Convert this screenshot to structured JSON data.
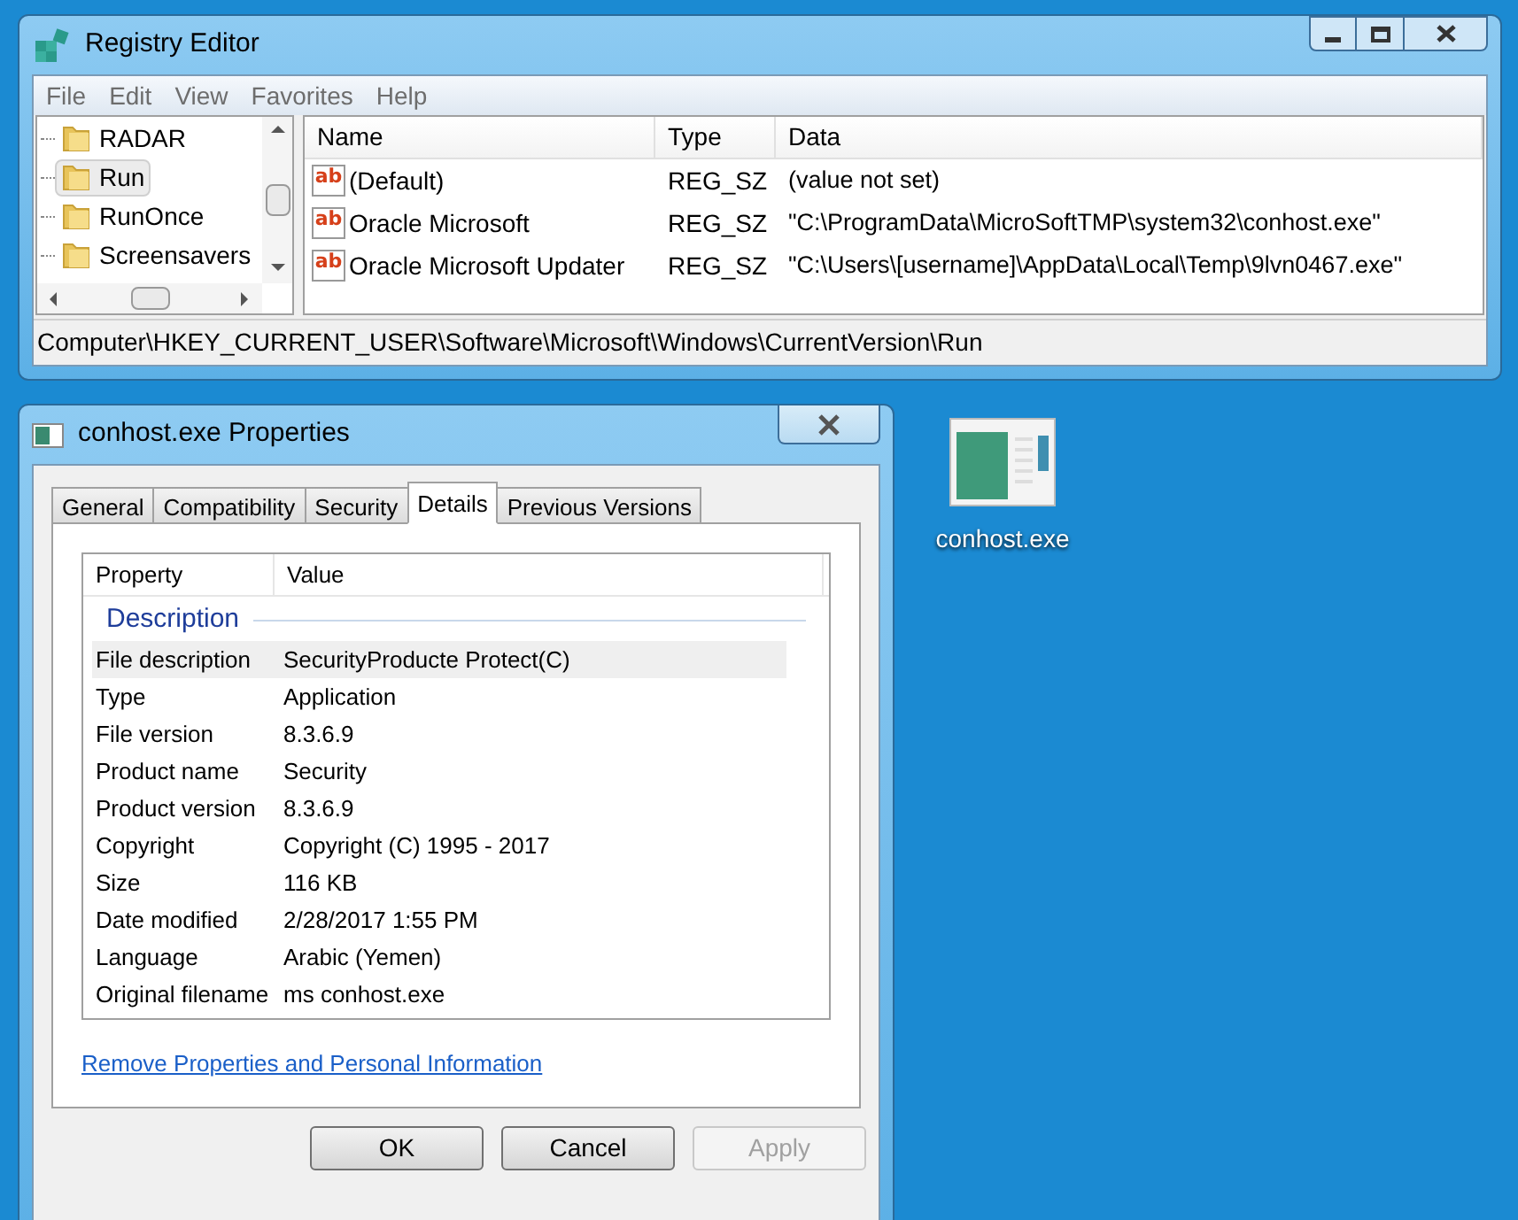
{
  "registry_editor": {
    "title": "Registry Editor",
    "menu": [
      "File",
      "Edit",
      "View",
      "Favorites",
      "Help"
    ],
    "tree": [
      {
        "label": "RADAR",
        "selected": false
      },
      {
        "label": "Run",
        "selected": true
      },
      {
        "label": "RunOnce",
        "selected": false
      },
      {
        "label": "Screensavers",
        "selected": false
      }
    ],
    "columns": [
      "Name",
      "Type",
      "Data"
    ],
    "rows": [
      {
        "icon": "ab",
        "name": "(Default)",
        "type": "REG_SZ",
        "data": "(value not set)"
      },
      {
        "icon": "ab",
        "name": "Oracle Microsoft",
        "type": "REG_SZ",
        "data": "\"C:\\ProgramData\\MicroSoftTMP\\system32\\conhost.exe\""
      },
      {
        "icon": "ab",
        "name": "Oracle Microsoft Updater",
        "type": "REG_SZ",
        "data": "\"C:\\Users\\[username]\\AppData\\Local\\Temp\\9lvn0467.exe\""
      }
    ],
    "status_bar": "Computer\\HKEY_CURRENT_USER\\Software\\Microsoft\\Windows\\CurrentVersion\\Run"
  },
  "properties_dialog": {
    "title": "conhost.exe Properties",
    "tabs": [
      {
        "label": "General",
        "selected": false
      },
      {
        "label": "Compatibility",
        "selected": false
      },
      {
        "label": "Security",
        "selected": false
      },
      {
        "label": "Details",
        "selected": true
      },
      {
        "label": "Previous Versions",
        "selected": false
      }
    ],
    "columns": [
      "Property",
      "Value"
    ],
    "section": "Description",
    "rows": [
      {
        "property": "File description",
        "value": "SecurityProducte Protect(C)",
        "selected": true
      },
      {
        "property": "Type",
        "value": "Application",
        "selected": false
      },
      {
        "property": "File version",
        "value": "8.3.6.9",
        "selected": false
      },
      {
        "property": "Product name",
        "value": "Security",
        "selected": false
      },
      {
        "property": "Product version",
        "value": "8.3.6.9",
        "selected": false
      },
      {
        "property": "Copyright",
        "value": "Copyright (C) 1995 - 2017",
        "selected": false
      },
      {
        "property": "Size",
        "value": "116 KB",
        "selected": false
      },
      {
        "property": "Date modified",
        "value": "2/28/2017 1:55 PM",
        "selected": false
      },
      {
        "property": "Language",
        "value": "Arabic (Yemen)",
        "selected": false
      },
      {
        "property": "Original filename",
        "value": "ms conhost.exe",
        "selected": false
      }
    ],
    "link": "Remove Properties and Personal Information",
    "buttons": [
      {
        "label": "OK",
        "disabled": false
      },
      {
        "label": "Cancel",
        "disabled": false
      },
      {
        "label": "Apply",
        "disabled": true
      }
    ]
  },
  "desktop_icon": {
    "label": "conhost.exe"
  }
}
